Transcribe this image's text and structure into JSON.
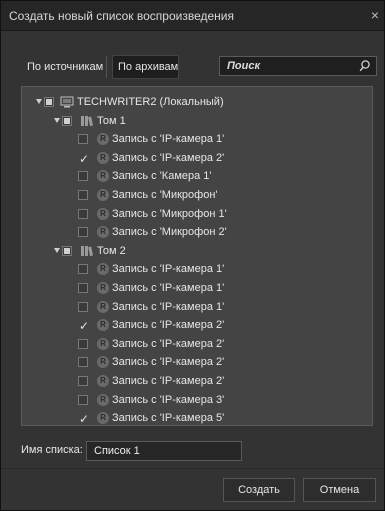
{
  "dialog": {
    "title": "Создать новый список воспроизведения",
    "close_glyph": "×"
  },
  "tabs": {
    "sources": "По источникам",
    "archives": "По архивам",
    "selected": "archives"
  },
  "search": {
    "value": "Поиск"
  },
  "tree": {
    "root": {
      "label": "TECHWRITER2 (Локальный)",
      "state": "partial",
      "expanded": true
    },
    "volumes": [
      {
        "label": "Том 1",
        "state": "partial",
        "expanded": true,
        "items": [
          {
            "label": "Запись с 'IP-камера 1'",
            "checked": false
          },
          {
            "label": "Запись с 'IP-камера 2'",
            "checked": true
          },
          {
            "label": "Запись с 'Камера 1'",
            "checked": false
          },
          {
            "label": "Запись с 'Микрофон'",
            "checked": false
          },
          {
            "label": "Запись с 'Микрофон 1'",
            "checked": false
          },
          {
            "label": "Запись с 'Микрофон 2'",
            "checked": false
          }
        ]
      },
      {
        "label": "Том 2",
        "state": "partial",
        "expanded": true,
        "items": [
          {
            "label": "Запись с 'IP-камера 1'",
            "checked": false
          },
          {
            "label": "Запись с 'IP-камера 1'",
            "checked": false
          },
          {
            "label": "Запись с 'IP-камера 1'",
            "checked": false
          },
          {
            "label": "Запись с 'IP-камера 2'",
            "checked": true
          },
          {
            "label": "Запись с 'IP-камера 2'",
            "checked": false
          },
          {
            "label": "Запись с 'IP-камера 2'",
            "checked": false
          },
          {
            "label": "Запись с 'IP-камера 2'",
            "checked": false
          },
          {
            "label": "Запись с 'IP-камера 3'",
            "checked": false
          },
          {
            "label": "Запись с 'IP-камера 5'",
            "checked": true
          }
        ]
      }
    ],
    "record_badge": "R",
    "check_glyph": "✓"
  },
  "list_name": {
    "label": "Имя списка:",
    "value": "Список 1"
  },
  "buttons": {
    "create": "Создать",
    "cancel": "Отмена"
  }
}
